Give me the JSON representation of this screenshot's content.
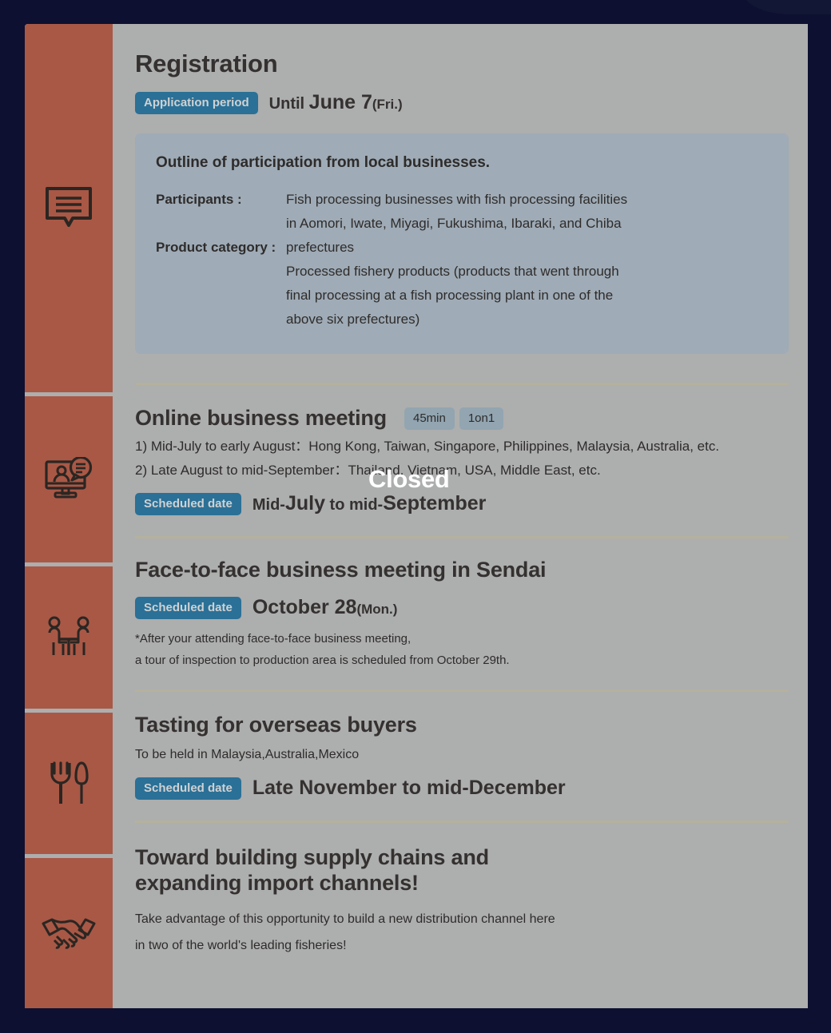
{
  "theme": {
    "page_background": "#0d1030",
    "card_background": "#adaeae",
    "sidebar_accent": "#a95846",
    "badge_background": "#2b7096",
    "tag_background": "#92a5b1",
    "outline_box_background": "#9fabb6",
    "divider": "#b5b19d",
    "heading_text": "#343130",
    "overlay_text": "#ffffff"
  },
  "sidebar": {
    "items": [
      {
        "icon": "speech-bubble-form-icon",
        "section": "registration"
      },
      {
        "icon": "online-meeting-monitor-icon",
        "section": "online-business-meeting"
      },
      {
        "icon": "two-people-at-table-icon",
        "section": "face-to-face-business-meeting"
      },
      {
        "icon": "fork-and-knife-icon",
        "section": "tasting"
      },
      {
        "icon": "handshake-icon",
        "section": "supply-chains"
      }
    ]
  },
  "registration": {
    "title": "Registration",
    "badge": "Application period",
    "date_prefix": "Until",
    "date_main": "June 7",
    "date_suffix": "(Fri.)",
    "outline": {
      "title": "Outline of participation from local businesses.",
      "rows": [
        {
          "label": "Participants :",
          "lines": [
            "Fish processing businesses with fish processing facilities",
            "in Aomori, Iwate, Miyagi, Fukushima, Ibaraki, and Chiba"
          ]
        },
        {
          "label": "Product category :",
          "lines": [
            "prefectures",
            "Processed fishery products (products that went through",
            "final processing at a fish processing plant in one of the",
            "above six prefectures)"
          ]
        }
      ]
    }
  },
  "online_meeting": {
    "title": "Online business meeting",
    "tags": [
      "45min",
      "1on1"
    ],
    "line1": "1) Mid-July to early August：Hong Kong, Taiwan, Singapore,  Philippines, Malaysia, Australia, etc.",
    "line2": "2) Late August to mid-September：Thailand, Vietnam, USA, Middle East, etc.",
    "badge": "Scheduled date",
    "date_prefix": "Mid-",
    "date_main1": "July",
    "date_middle": " to mid-",
    "date_main2": "September",
    "overlay": "Closed"
  },
  "face_to_face": {
    "title": "Face-to-face business meeting in Sendai",
    "badge": "Scheduled date",
    "date_main": "October 28",
    "date_suffix": "(Mon.)",
    "note_line1": "*After your attending face-to-face business meeting,",
    "note_line2": "a tour of inspection to production area is scheduled from October 29th."
  },
  "tasting": {
    "title": "Tasting for overseas buyers",
    "subtitle": "To be held in Malaysia,Australia,Mexico",
    "badge": "Scheduled date",
    "date_main": "Late November to mid-December"
  },
  "supply_chains": {
    "title_line1": "Toward building supply chains and",
    "title_line2": "expanding import channels!",
    "body_line1": "Take advantage of this opportunity to build a new distribution channel here",
    "body_line2": "in two of the world's leading fisheries!"
  }
}
